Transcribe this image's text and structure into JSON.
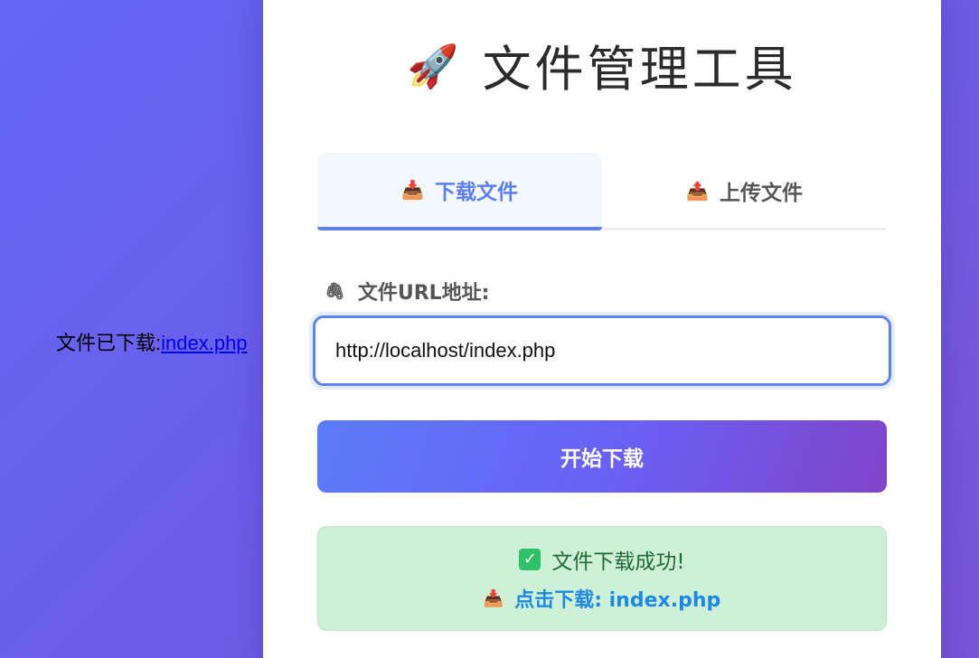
{
  "status": {
    "text": "文件已下载:",
    "link": "index.php"
  },
  "header": {
    "icon": "rocket-icon",
    "icon_glyph": "🚀",
    "title": "文件管理工具"
  },
  "tabs": [
    {
      "label": "下载文件",
      "icon": "inbox-download-icon",
      "glyph": "📥",
      "active": true
    },
    {
      "label": "上传文件",
      "icon": "outbox-upload-icon",
      "glyph": "📤",
      "active": false
    }
  ],
  "form": {
    "label": "文件URL地址:",
    "label_icon": "paperclip-icon",
    "label_glyph": "🖇",
    "url_value": "http://localhost/index.php",
    "submit_label": "开始下载"
  },
  "result": {
    "message": "文件下载成功!",
    "check_glyph": "✓",
    "link_glyph": "📥",
    "link_label": "点击下载: index.php"
  },
  "colors": {
    "accent": "#5b7ff0",
    "success_bg": "#cdf0d7",
    "success_text": "#1f6b36",
    "link": "#1e88e5"
  }
}
